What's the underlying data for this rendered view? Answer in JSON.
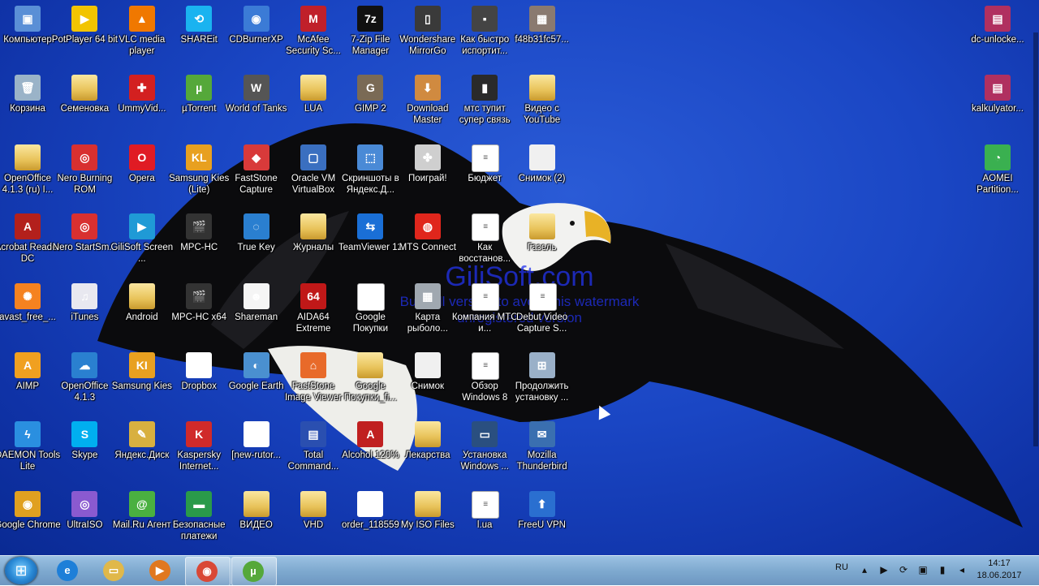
{
  "desktop": {
    "watermark_title": "GiliSoft.com",
    "watermark_line1": "Buy full version to avoid this watermark",
    "watermark_line2": "unregistered version",
    "icons": [
      {
        "label": "Компьютер",
        "icon": "computer-icon",
        "color": "#5a8fd6",
        "glyph": "▣"
      },
      {
        "label": "PotPlayer 64 bit",
        "icon": "potplayer-icon",
        "color": "#f2c400",
        "glyph": "▶"
      },
      {
        "label": "VLC media player",
        "icon": "vlc-icon",
        "color": "#f07800",
        "glyph": "▲"
      },
      {
        "label": "SHAREit",
        "icon": "shareit-icon",
        "color": "#1ab3f0",
        "glyph": "⟲"
      },
      {
        "label": "CDBurnerXP",
        "icon": "cdburner-icon",
        "color": "#3b7bd6",
        "glyph": "◉"
      },
      {
        "label": "McAfee Security Sc...",
        "icon": "mcafee-icon",
        "color": "#c0202a",
        "glyph": "M"
      },
      {
        "label": "7-Zip File Manager",
        "icon": "7zip-icon",
        "color": "#111111",
        "glyph": "7z"
      },
      {
        "label": "Wondershare MirrorGo",
        "icon": "mirrorgo-icon",
        "color": "#3a3a3a",
        "glyph": "▯"
      },
      {
        "label": "Как быстро испортит...",
        "icon": "video-file-icon",
        "color": "#444444",
        "glyph": "▪"
      },
      {
        "label": "f48b31fc57...",
        "icon": "image-file-icon",
        "color": "#8a7a70",
        "glyph": "▦"
      },
      {
        "label": "Корзина",
        "icon": "recycle-bin-icon",
        "color": "#9ab3c8",
        "glyph": "🗑"
      },
      {
        "label": "Семеновка",
        "icon": "folder-icon",
        "color": "folder",
        "glyph": ""
      },
      {
        "label": "UmmyVid...",
        "icon": "ummy-icon",
        "color": "#d32020",
        "glyph": "✚"
      },
      {
        "label": "µTorrent",
        "icon": "utorrent-icon",
        "color": "#55a83a",
        "glyph": "µ"
      },
      {
        "label": "World of Tanks",
        "icon": "wot-icon",
        "color": "#555555",
        "glyph": "W"
      },
      {
        "label": "LUA",
        "icon": "folder-icon",
        "color": "folder",
        "glyph": ""
      },
      {
        "label": "GIMP 2",
        "icon": "gimp-icon",
        "color": "#7a6a55",
        "glyph": "G"
      },
      {
        "label": "Download Master",
        "icon": "download-master-icon",
        "color": "#d08a40",
        "glyph": "⬇"
      },
      {
        "label": "мтс тупит супер связь",
        "icon": "phone-icon",
        "color": "#2a2a2a",
        "glyph": "▮"
      },
      {
        "label": "Видео с YouTube",
        "icon": "folder-icon",
        "color": "folder",
        "glyph": ""
      },
      {
        "label": "OpenOffice 4.1.3 (ru) I...",
        "icon": "folder-icon",
        "color": "folder",
        "glyph": ""
      },
      {
        "label": "Nero Burning ROM",
        "icon": "nero-icon",
        "color": "#d83030",
        "glyph": "◎"
      },
      {
        "label": "Opera",
        "icon": "opera-icon",
        "color": "#e01b24",
        "glyph": "O"
      },
      {
        "label": "Samsung Kies (Lite)",
        "icon": "kies-icon",
        "color": "#e8a020",
        "glyph": "KL"
      },
      {
        "label": "FastStone Capture",
        "icon": "faststone-capture-icon",
        "color": "#d83a3a",
        "glyph": "◆"
      },
      {
        "label": "Oracle VM VirtualBox",
        "icon": "virtualbox-icon",
        "color": "#3a6fc0",
        "glyph": "▢"
      },
      {
        "label": "Скриншоты в Яндекс.Д...",
        "icon": "screenshot-icon",
        "color": "#4a8ad6",
        "glyph": "⬚"
      },
      {
        "label": "Поиграй!",
        "icon": "gamepad-icon",
        "color": "#cfcfcf",
        "glyph": "✤"
      },
      {
        "label": "Бюджет",
        "icon": "document-icon",
        "color": "doc",
        "glyph": "≡"
      },
      {
        "label": "Снимок (2)",
        "icon": "image-file-icon",
        "color": "#f0f0f0",
        "glyph": ""
      },
      {
        "label": "Acrobat Reader DC",
        "icon": "acrobat-icon",
        "color": "#b3201c",
        "glyph": "A"
      },
      {
        "label": "Nero StartSm...",
        "icon": "nero-icon",
        "color": "#d83030",
        "glyph": "◎"
      },
      {
        "label": "GiliSoft Screen ...",
        "icon": "gilisoft-icon",
        "color": "#1f9ad6",
        "glyph": "▶"
      },
      {
        "label": "MPC-HC",
        "icon": "mpc-icon",
        "color": "#333333",
        "glyph": "🎬"
      },
      {
        "label": "True Key",
        "icon": "truekey-icon",
        "color": "#2a7fd0",
        "glyph": "◌"
      },
      {
        "label": "Журналы",
        "icon": "folder-icon",
        "color": "folder",
        "glyph": ""
      },
      {
        "label": "TeamViewer 12",
        "icon": "teamviewer-icon",
        "color": "#1a6fd6",
        "glyph": "⇆"
      },
      {
        "label": "MTS Connect",
        "icon": "mts-icon",
        "color": "#e0261c",
        "glyph": "◍"
      },
      {
        "label": "Как восстанов...",
        "icon": "document-icon",
        "color": "doc",
        "glyph": "≡"
      },
      {
        "label": "Газель",
        "icon": "folder-icon",
        "color": "folder",
        "glyph": ""
      },
      {
        "label": "avast_free_...",
        "icon": "avast-icon",
        "color": "#f58220",
        "glyph": "✺"
      },
      {
        "label": "iTunes",
        "icon": "itunes-icon",
        "color": "#e8e8f0",
        "glyph": "♫"
      },
      {
        "label": "Android",
        "icon": "folder-icon",
        "color": "folder",
        "glyph": ""
      },
      {
        "label": "MPC-HC x64",
        "icon": "mpc-icon",
        "color": "#333333",
        "glyph": "🎬"
      },
      {
        "label": "Shareman",
        "icon": "shareman-icon",
        "color": "#f5f5f5",
        "glyph": "☻"
      },
      {
        "label": "AIDA64 Extreme",
        "icon": "aida64-icon",
        "color": "#c01818",
        "glyph": "64"
      },
      {
        "label": "Google Покупки",
        "icon": "document-icon",
        "color": "doc",
        "glyph": ""
      },
      {
        "label": "Карта рыболо...",
        "icon": "image-file-icon",
        "color": "#a0a8b0",
        "glyph": "▦"
      },
      {
        "label": "Компания МТС и...",
        "icon": "document-icon",
        "color": "doc",
        "glyph": "≡"
      },
      {
        "label": "Debut Video Capture S...",
        "icon": "document-icon",
        "color": "doc",
        "glyph": "≡"
      },
      {
        "label": "AIMP",
        "icon": "aimp-icon",
        "color": "#f0a020",
        "glyph": "A"
      },
      {
        "label": "OpenOffice 4.1.3",
        "icon": "openoffice-icon",
        "color": "#2a80d0",
        "glyph": "☁"
      },
      {
        "label": "Samsung Kies",
        "icon": "kies-icon",
        "color": "#e8a020",
        "glyph": "KI"
      },
      {
        "label": "Dropbox",
        "icon": "dropbox-icon",
        "color": "#ffffff",
        "glyph": "❖"
      },
      {
        "label": "Google Earth",
        "icon": "google-earth-icon",
        "color": "#4a90d0",
        "glyph": "◐"
      },
      {
        "label": "FastStone Image Viewer",
        "icon": "faststone-viewer-icon",
        "color": "#e86a2a",
        "glyph": "⌂"
      },
      {
        "label": "Google Покупки_fi...",
        "icon": "folder-icon",
        "color": "folder",
        "glyph": ""
      },
      {
        "label": "Снимок",
        "icon": "image-file-icon",
        "color": "#f0f0f0",
        "glyph": ""
      },
      {
        "label": "Обзор Windows 8",
        "icon": "document-icon",
        "color": "doc",
        "glyph": "≡"
      },
      {
        "label": "Продолжить установку ...",
        "icon": "installer-icon",
        "color": "#9ab0c8",
        "glyph": "⊞"
      },
      {
        "label": "DAEMON Tools Lite",
        "icon": "daemon-icon",
        "color": "#2a8fe0",
        "glyph": "ϟ"
      },
      {
        "label": "Skype",
        "icon": "skype-icon",
        "color": "#00aff0",
        "glyph": "S"
      },
      {
        "label": "Яндекс.Диск",
        "icon": "yandex-disk-icon",
        "color": "#d8b040",
        "glyph": "✎"
      },
      {
        "label": "Kaspersky Internet...",
        "icon": "kaspersky-icon",
        "color": "#d02a2a",
        "glyph": "K"
      },
      {
        "label": "[new-rutor...",
        "icon": "torrent-file-icon",
        "color": "#ffffff",
        "glyph": "µ"
      },
      {
        "label": "Total Command...",
        "icon": "total-commander-icon",
        "color": "#2a4fb0",
        "glyph": "▤"
      },
      {
        "label": "Alcohol 120%",
        "icon": "alcohol-icon",
        "color": "#c02020",
        "glyph": "A"
      },
      {
        "label": "Лекарства",
        "icon": "folder-icon",
        "color": "folder",
        "glyph": ""
      },
      {
        "label": "Установка Windows ...",
        "icon": "video-file-icon",
        "color": "#2a4f80",
        "glyph": "▭"
      },
      {
        "label": "Mozilla Thunderbird",
        "icon": "thunderbird-icon",
        "color": "#3a6fb0",
        "glyph": "✉"
      },
      {
        "label": "Google Chrome",
        "icon": "chrome-icon",
        "color": "#e0a020",
        "glyph": "◉"
      },
      {
        "label": "UltraISO",
        "icon": "ultraiso-icon",
        "color": "#8a5ad0",
        "glyph": "◎"
      },
      {
        "label": "Mail.Ru Агент",
        "icon": "mailru-agent-icon",
        "color": "#4ab040",
        "glyph": "@"
      },
      {
        "label": "Безопасные платежи",
        "icon": "safe-payments-icon",
        "color": "#2a9a4a",
        "glyph": "▬"
      },
      {
        "label": "ВИДЕО",
        "icon": "folder-icon",
        "color": "folder",
        "glyph": ""
      },
      {
        "label": "VHD",
        "icon": "folder-icon",
        "color": "folder",
        "glyph": ""
      },
      {
        "label": "order_118559",
        "icon": "pdf-file-icon",
        "color": "#ffffff",
        "glyph": "PDF"
      },
      {
        "label": "My ISO Files",
        "icon": "folder-icon",
        "color": "folder",
        "glyph": ""
      },
      {
        "label": "l.ua",
        "icon": "document-icon",
        "color": "doc",
        "glyph": "≡"
      },
      {
        "label": "FreeU VPN",
        "icon": "freeu-vpn-icon",
        "color": "#2a6fd0",
        "glyph": "⬆"
      }
    ],
    "right_icons": [
      {
        "label": "dc-unlocke...",
        "icon": "winrar-icon",
        "color": "#b03060",
        "glyph": "▤"
      },
      {
        "label": "kalkulyator...",
        "icon": "winrar-icon",
        "color": "#b03060",
        "glyph": "▤"
      },
      {
        "label": "AOMEI Partition...",
        "icon": "aomei-icon",
        "color": "#3ab050",
        "glyph": "◔"
      }
    ]
  },
  "taskbar": {
    "start_glyph": "⊞",
    "buttons": [
      {
        "name": "ie-taskbar-button",
        "icon": "internet-explorer-icon",
        "color": "#1e7fd8",
        "glyph": "e",
        "active": false
      },
      {
        "name": "explorer-taskbar-button",
        "icon": "file-explorer-icon",
        "color": "#e0b84a",
        "glyph": "▭",
        "active": false
      },
      {
        "name": "media-player-taskbar-button",
        "icon": "media-player-icon",
        "color": "#e07820",
        "glyph": "▶",
        "active": false
      },
      {
        "name": "chrome-taskbar-button",
        "icon": "chrome-icon",
        "color": "#d94836",
        "glyph": "◉",
        "active": true
      },
      {
        "name": "utorrent-taskbar-button",
        "icon": "utorrent-icon",
        "color": "#55a83a",
        "glyph": "µ",
        "active": true
      }
    ],
    "tray": {
      "language": "RU",
      "icons": [
        "arrow-up-icon",
        "camera-icon",
        "network-sync-icon",
        "usb-icon",
        "signal-icon",
        "volume-icon"
      ],
      "icon_glyphs": [
        "▴",
        "▶",
        "⟳",
        "▣",
        "▮",
        "◂"
      ]
    },
    "clock": {
      "time": "14:17",
      "date": "18.06.2017"
    }
  }
}
